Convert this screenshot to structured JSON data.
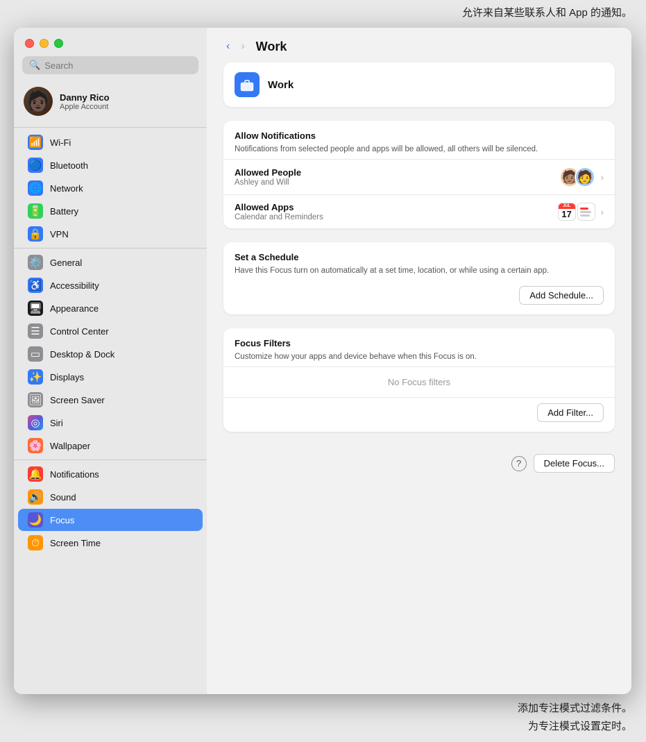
{
  "annotations": {
    "top": "允许来自某些联系人和 App 的通知。",
    "bottom_line1": "添加专注模式过滤条件。",
    "bottom_line2": "为专注模式设置定时。"
  },
  "sidebar": {
    "search_placeholder": "Search",
    "user": {
      "name": "Danny Rico",
      "subtitle": "Apple Account"
    },
    "items": [
      {
        "id": "wifi",
        "label": "Wi-Fi",
        "icon": "wifi"
      },
      {
        "id": "bluetooth",
        "label": "Bluetooth",
        "icon": "bluetooth"
      },
      {
        "id": "network",
        "label": "Network",
        "icon": "network"
      },
      {
        "id": "battery",
        "label": "Battery",
        "icon": "battery"
      },
      {
        "id": "vpn",
        "label": "VPN",
        "icon": "vpn"
      },
      {
        "id": "general",
        "label": "General",
        "icon": "general"
      },
      {
        "id": "accessibility",
        "label": "Accessibility",
        "icon": "accessibility"
      },
      {
        "id": "appearance",
        "label": "Appearance",
        "icon": "appearance"
      },
      {
        "id": "controlcenter",
        "label": "Control Center",
        "icon": "controlcenter"
      },
      {
        "id": "desktopdock",
        "label": "Desktop & Dock",
        "icon": "desktopdock"
      },
      {
        "id": "displays",
        "label": "Displays",
        "icon": "displays"
      },
      {
        "id": "screensaver",
        "label": "Screen Saver",
        "icon": "screensaver"
      },
      {
        "id": "siri",
        "label": "Siri",
        "icon": "siri"
      },
      {
        "id": "wallpaper",
        "label": "Wallpaper",
        "icon": "wallpaper"
      },
      {
        "id": "notifications",
        "label": "Notifications",
        "icon": "notifications"
      },
      {
        "id": "sound",
        "label": "Sound",
        "icon": "sound"
      },
      {
        "id": "focus",
        "label": "Focus",
        "icon": "focus",
        "active": true
      },
      {
        "id": "screentime",
        "label": "Screen Time",
        "icon": "screentime"
      }
    ]
  },
  "main": {
    "title": "Work",
    "focus_card": {
      "label": "Work"
    },
    "allow_notifications": {
      "title": "Allow Notifications",
      "desc": "Notifications from selected people and apps will be allowed, all others will be silenced.",
      "allowed_people": {
        "title": "Allowed People",
        "subtitle": "Ashley and Will"
      },
      "allowed_apps": {
        "title": "Allowed Apps",
        "subtitle": "Calendar and Reminders",
        "calendar_month": "JUL",
        "calendar_day": "17"
      }
    },
    "set_schedule": {
      "title": "Set a Schedule",
      "desc": "Have this Focus turn on automatically at a set time, location, or while using a certain app.",
      "add_schedule_label": "Add Schedule..."
    },
    "focus_filters": {
      "title": "Focus Filters",
      "desc": "Customize how your apps and device behave when this Focus is on.",
      "no_filters": "No Focus filters",
      "add_filter_label": "Add Filter..."
    },
    "delete_focus_label": "Delete Focus...",
    "help_label": "?"
  }
}
